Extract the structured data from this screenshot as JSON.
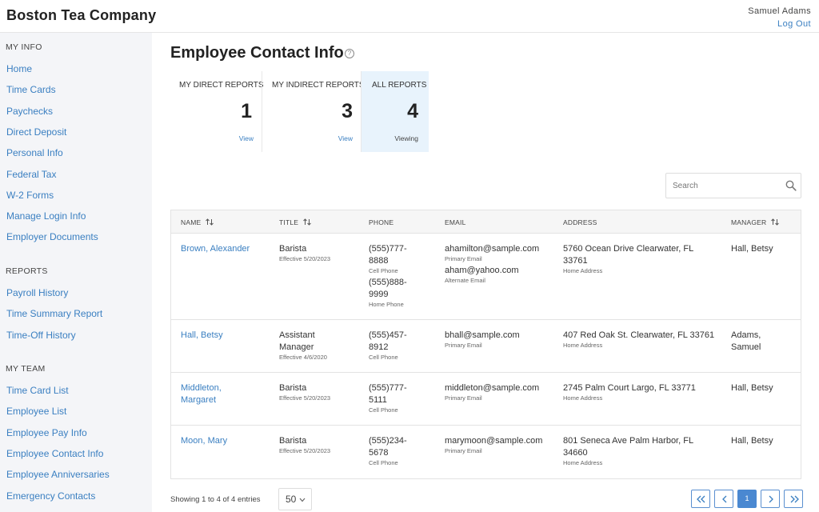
{
  "header": {
    "brand": "Boston Tea Company",
    "user_name": "Samuel Adams",
    "logout_label": "Log Out"
  },
  "sidebar": {
    "sections": [
      {
        "heading": "MY INFO",
        "items": [
          "Home",
          "Time Cards",
          "Paychecks",
          "Direct Deposit",
          "Personal Info",
          "Federal Tax",
          "W-2 Forms",
          "Manage Login Info",
          "Employer Documents"
        ]
      },
      {
        "heading": "REPORTS",
        "items": [
          "Payroll History",
          "Time Summary Report",
          "Time-Off History"
        ]
      },
      {
        "heading": "MY TEAM",
        "items": [
          "Time Card List",
          "Employee List",
          "Employee Pay Info",
          "Employee Contact Info",
          "Employee Anniversaries",
          "Emergency Contacts"
        ]
      }
    ]
  },
  "page": {
    "title": "Employee Contact Info",
    "help_glyph": "?"
  },
  "report_cards": [
    {
      "label": "MY DIRECT REPORTS",
      "count": "1",
      "link": "View",
      "active": false
    },
    {
      "label": "MY INDIRECT REPORTS",
      "count": "3",
      "link": "View",
      "active": false
    },
    {
      "label": "ALL REPORTS",
      "count": "4",
      "link": "Viewing",
      "active": true
    }
  ],
  "search": {
    "placeholder": "Search",
    "value": ""
  },
  "table": {
    "columns": [
      "NAME",
      "TITLE",
      "PHONE",
      "EMAIL",
      "ADDRESS",
      "MANAGER"
    ],
    "rows": [
      {
        "name_lines": [
          "Brown, Alexander"
        ],
        "title_lines": [
          "Barista"
        ],
        "effective": "Effective 5/20/2023",
        "phones": [
          {
            "lines": [
              "(555)777-",
              "8888"
            ],
            "type": "Cell Phone"
          },
          {
            "lines": [
              "(555)888-",
              "9999"
            ],
            "type": "Home Phone"
          }
        ],
        "emails": [
          {
            "value": "ahamilton@sample.com",
            "type": "Primary Email"
          },
          {
            "value": "aham@yahoo.com",
            "type": "Alternate Email"
          }
        ],
        "address_lines": [
          "5760 Ocean Drive Clearwater, FL",
          "33761"
        ],
        "address_type": "Home Address",
        "manager_lines": [
          "Hall, Betsy"
        ]
      },
      {
        "name_lines": [
          "Hall, Betsy"
        ],
        "title_lines": [
          "Assistant",
          "Manager"
        ],
        "effective": "Effective 4/6/2020",
        "phones": [
          {
            "lines": [
              "(555)457-",
              "8912"
            ],
            "type": "Cell Phone"
          }
        ],
        "emails": [
          {
            "value": "bhall@sample.com",
            "type": "Primary Email"
          }
        ],
        "address_lines": [
          "407 Red Oak St. Clearwater, FL 33761"
        ],
        "address_type": "Home Address",
        "manager_lines": [
          "Adams,",
          "Samuel"
        ]
      },
      {
        "name_lines": [
          "Middleton,",
          "Margaret"
        ],
        "title_lines": [
          "Barista"
        ],
        "effective": "Effective 5/20/2023",
        "phones": [
          {
            "lines": [
              "(555)777-",
              "5111"
            ],
            "type": "Cell Phone"
          }
        ],
        "emails": [
          {
            "value": "middleton@sample.com",
            "type": "Primary Email"
          }
        ],
        "address_lines": [
          "2745 Palm Court Largo, FL 33771"
        ],
        "address_type": "Home Address",
        "manager_lines": [
          "Hall, Betsy"
        ]
      },
      {
        "name_lines": [
          "Moon, Mary"
        ],
        "title_lines": [
          "Barista"
        ],
        "effective": "Effective 5/20/2023",
        "phones": [
          {
            "lines": [
              "(555)234-",
              "5678"
            ],
            "type": "Cell Phone"
          }
        ],
        "emails": [
          {
            "value": "marymoon@sample.com",
            "type": "Primary Email"
          }
        ],
        "address_lines": [
          "801 Seneca Ave Palm Harbor, FL",
          "34660"
        ],
        "address_type": "Home Address",
        "manager_lines": [
          "Hall, Betsy"
        ]
      }
    ]
  },
  "footer": {
    "showing_text": "Showing 1 to 4 of 4 entries",
    "page_size": "50",
    "current_page": "1"
  },
  "colors": {
    "link": "#3a7fc1",
    "active_card_bg": "#e8f3fc",
    "sidebar_bg": "#f4f5f8",
    "active_page_bg": "#4a88d1"
  },
  "icons": [
    "help-icon",
    "search-icon",
    "sort-icon",
    "chevron-down-icon",
    "first-page-icon",
    "prev-page-icon",
    "next-page-icon",
    "last-page-icon"
  ]
}
